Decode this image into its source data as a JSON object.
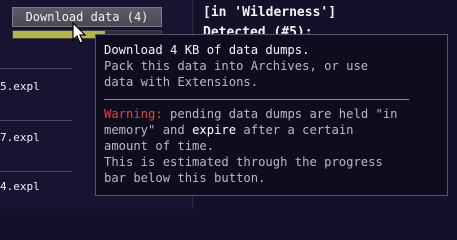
{
  "download_button": {
    "label": "Download data (4)"
  },
  "download_progress": {
    "fraction": 0.62
  },
  "files": [
    "5.expl",
    "7.expl",
    "4.expl"
  ],
  "location": "[in 'Wilderness']",
  "detected": "Detected (#5):",
  "tooltip": {
    "line1": "Download 4 KB of data dumps.",
    "line2": "Pack this data into Archives, or use",
    "line3": "data with Extensions.",
    "warning_label": "Warning:",
    "warning_rest1": " pending data dumps are held \"in",
    "warning_memory": "memory",
    "warning_and": "\" and ",
    "warning_expire": "expire",
    "warning_after": " after a certain",
    "line5": "amount of time.",
    "line6": "This is estimated through the progress",
    "line7": "bar below this button."
  },
  "colors": {
    "warning": "#e0463c",
    "progress": "#b7b544",
    "background": "#14102a"
  }
}
